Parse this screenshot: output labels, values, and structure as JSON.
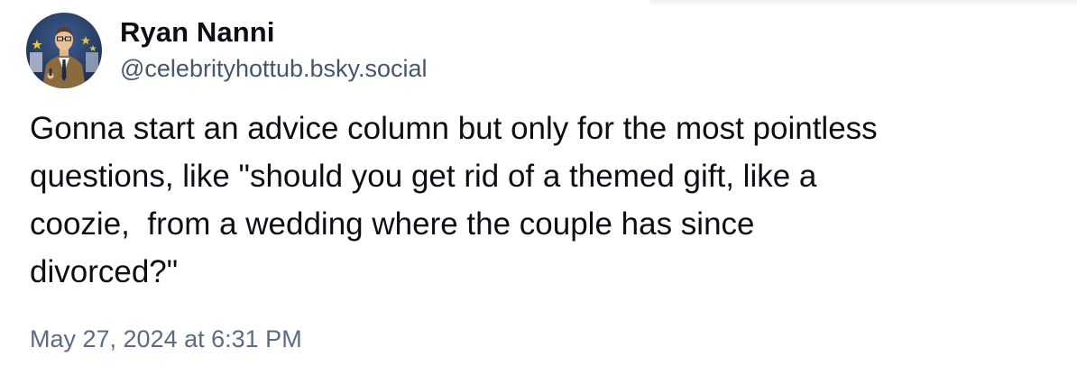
{
  "post": {
    "author": {
      "display_name": "Ryan Nanni",
      "handle": "@celebrityhottub.bsky.social",
      "avatar_icon": "profile-photo-avatar"
    },
    "text": "Gonna start an advice column but only for the most pointless\nquestions, like \"should you get rid of a themed gift, like a\ncoozie,  from a wedding where the couple has since\ndivorced?\"",
    "timestamp": "May 27, 2024 at 6:31 PM"
  },
  "colors": {
    "text_primary": "#0b0f14",
    "text_secondary": "#46566b",
    "timestamp": "#5b6b80",
    "background": "#ffffff"
  }
}
